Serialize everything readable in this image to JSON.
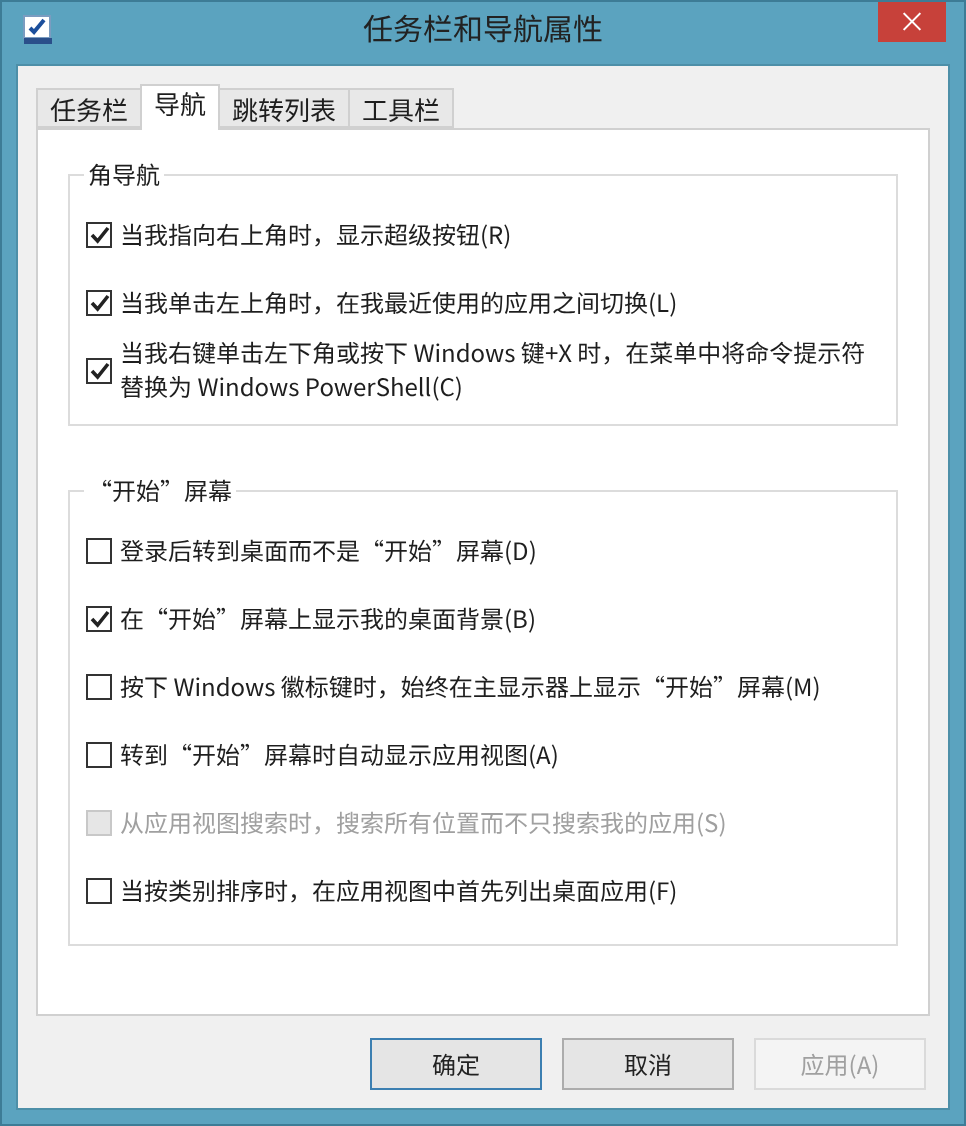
{
  "window": {
    "title": "任务栏和导航属性",
    "close": "×"
  },
  "tabs": [
    {
      "label": "任务栏",
      "selected": false
    },
    {
      "label": "导航",
      "selected": true
    },
    {
      "label": "跳转列表",
      "selected": false
    },
    {
      "label": "工具栏",
      "selected": false
    }
  ],
  "groups": [
    {
      "title": "角导航",
      "items": [
        {
          "label": "当我指向右上角时，显示超级按钮(R)",
          "checked": true,
          "disabled": false
        },
        {
          "label": "当我单击左上角时，在我最近使用的应用之间切换(L)",
          "checked": true,
          "disabled": false
        },
        {
          "label": "当我右键单击左下角或按下 Windows 键+X 时，在菜单中将命令提示符替换为 Windows PowerShell(C)",
          "checked": true,
          "disabled": false
        }
      ]
    },
    {
      "title": "“开始”屏幕",
      "items": [
        {
          "label": "登录后转到桌面而不是“开始”屏幕(D)",
          "checked": false,
          "disabled": false
        },
        {
          "label": "在“开始”屏幕上显示我的桌面背景(B)",
          "checked": true,
          "disabled": false
        },
        {
          "label": "按下 Windows 徽标键时，始终在主显示器上显示“开始”屏幕(M)",
          "checked": false,
          "disabled": false
        },
        {
          "label": "转到“开始”屏幕时自动显示应用视图(A)",
          "checked": false,
          "disabled": false
        },
        {
          "label": "从应用视图搜索时，搜索所有位置而不只搜索我的应用(S)",
          "checked": false,
          "disabled": true
        },
        {
          "label": "当按类别排序时，在应用视图中首先列出桌面应用(F)",
          "checked": false,
          "disabled": false
        }
      ]
    }
  ],
  "buttons": [
    {
      "label": "确定",
      "default": true,
      "disabled": false
    },
    {
      "label": "取消",
      "default": false,
      "disabled": false
    },
    {
      "label": "应用(A)",
      "default": false,
      "disabled": true
    }
  ]
}
